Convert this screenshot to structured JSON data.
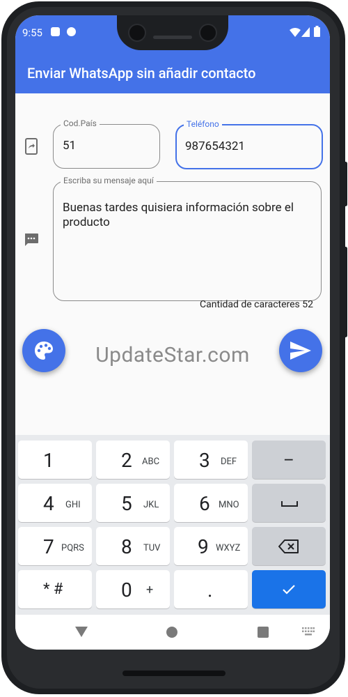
{
  "status_bar": {
    "time": "9:55"
  },
  "app_bar": {
    "title": "Enviar WhatsApp sin añadir contacto"
  },
  "form": {
    "country_code": {
      "label": "Cod.País",
      "value": "51"
    },
    "phone": {
      "label": "Teléfono",
      "value": "987654321"
    },
    "message": {
      "label": "Escriba su mensaje aquí",
      "value": "Buenas tardes quisiera información sobre el producto"
    },
    "char_count": "Cantidad de caracteres 52"
  },
  "watermark": "UpdateStar.com",
  "keyboard": {
    "rows": [
      [
        {
          "main": "1",
          "sub": ""
        },
        {
          "main": "2",
          "sub": "ABC"
        },
        {
          "main": "3",
          "sub": "DEF"
        },
        {
          "main": "–",
          "sub": ""
        }
      ],
      [
        {
          "main": "4",
          "sub": "GHI"
        },
        {
          "main": "5",
          "sub": "JKL"
        },
        {
          "main": "6",
          "sub": "MNO"
        },
        {
          "main": "␣",
          "sub": ""
        }
      ],
      [
        {
          "main": "7",
          "sub": "PQRS"
        },
        {
          "main": "8",
          "sub": "TUV"
        },
        {
          "main": "9",
          "sub": "WXYZ"
        },
        {
          "main": "⌫",
          "sub": ""
        }
      ],
      [
        {
          "main": "* #",
          "sub": ""
        },
        {
          "main": "0",
          "sub": "+"
        },
        {
          "main": ".",
          "sub": ""
        },
        {
          "main": "✓",
          "sub": ""
        }
      ]
    ]
  },
  "icons": {
    "phone_forward": "phone-forward-icon",
    "message": "message-icon",
    "palette": "palette-icon",
    "send": "send-icon",
    "nav_back": "back-triangle-icon",
    "nav_home": "home-circle-icon",
    "nav_recents": "recents-square-icon",
    "keyboard_switch": "keyboard-icon"
  },
  "colors": {
    "primary": "#4472e8",
    "keyboard_accent": "#1a73e8"
  }
}
